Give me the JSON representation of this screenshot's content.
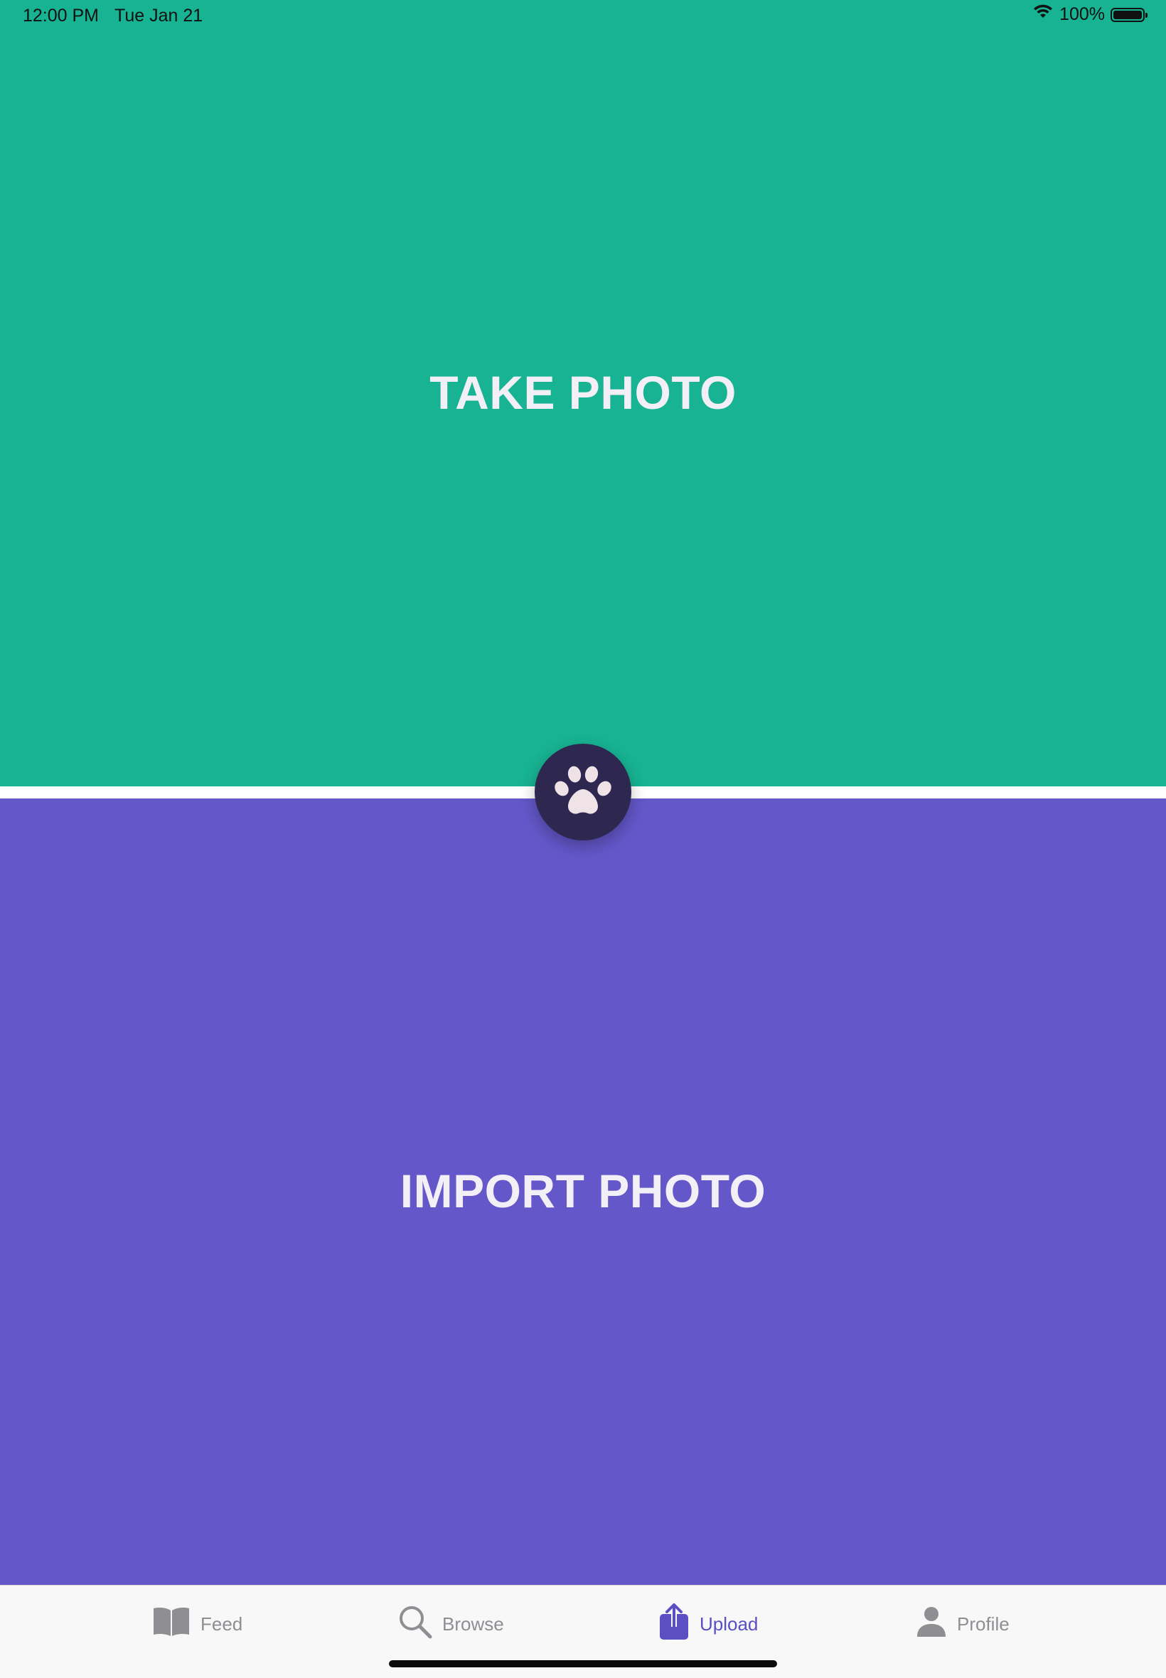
{
  "status_bar": {
    "time": "12:00 PM",
    "date": "Tue Jan 21",
    "battery": "100%",
    "icons": [
      "wifi-icon",
      "battery-icon"
    ]
  },
  "panels": {
    "take_photo": {
      "label": "TAKE PHOTO",
      "color": "#17b392"
    },
    "import_photo": {
      "label": "IMPORT PHOTO",
      "color": "#6457c9"
    }
  },
  "center_badge": {
    "icon": "paw-icon",
    "background": "#2e2850"
  },
  "tab_bar": {
    "active_color": "#5b4fc4",
    "inactive_color": "#8e8e93",
    "tabs": [
      {
        "label": "Feed",
        "icon": "book-icon",
        "active": false
      },
      {
        "label": "Browse",
        "icon": "search-icon",
        "active": false
      },
      {
        "label": "Upload",
        "icon": "share-icon",
        "active": true
      },
      {
        "label": "Profile",
        "icon": "person-icon",
        "active": false
      }
    ]
  }
}
